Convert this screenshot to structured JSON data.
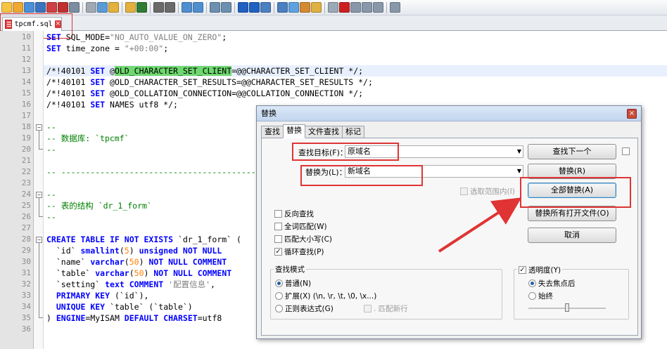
{
  "colors": {
    "accent": "#3c7fb1",
    "highlight_red": "#e03434",
    "match_green": "#6fd86f",
    "keyword": "#0000ff",
    "comment": "#008000"
  },
  "file_tab": {
    "label": "tpcmf.sql",
    "icon": "document-icon",
    "close_icon": "close-icon"
  },
  "toolbar_icons": [
    "new-file-icon",
    "open-icon",
    "save-icon",
    "save-all-icon",
    "close-icon",
    "close-all-icon",
    "print-icon",
    "cut-icon",
    "copy-icon",
    "paste-icon",
    "undo-icon",
    "redo-icon",
    "find-icon",
    "replace-icon",
    "zoom-in-icon",
    "zoom-out-icon",
    "sync-v-icon",
    "sync-h-icon",
    "wrap-icon",
    "all-chars-icon",
    "indent-guide-icon",
    "udl-icon",
    "doc-map-icon",
    "function-list-icon",
    "folder-icon",
    "monitor-icon",
    "record-icon",
    "stop-icon",
    "play-icon",
    "play-multi-icon",
    "save-macro-icon"
  ],
  "lines": [
    {
      "n": "10",
      "t": "SET SQL_MODE=\"NO_AUTO_VALUE_ON_ZERO\";"
    },
    {
      "n": "11",
      "t": "SET time_zone = \"+00:00\";"
    },
    {
      "n": "12",
      "t": ""
    },
    {
      "n": "13",
      "t": "/*!40101 SET @OLD_CHARACTER_SET_CLIENT=@@CHARACTER_SET_CLIENT */;"
    },
    {
      "n": "14",
      "t": "/*!40101 SET @OLD_CHARACTER_SET_RESULTS=@@CHARACTER_SET_RESULTS */;"
    },
    {
      "n": "15",
      "t": "/*!40101 SET @OLD_COLLATION_CONNECTION=@@COLLATION_CONNECTION */;"
    },
    {
      "n": "16",
      "t": "/*!40101 SET NAMES utf8 */;"
    },
    {
      "n": "17",
      "t": ""
    },
    {
      "n": "18",
      "t": "--"
    },
    {
      "n": "19",
      "t": "-- 数据库: `tpcmf`"
    },
    {
      "n": "20",
      "t": "--"
    },
    {
      "n": "21",
      "t": ""
    },
    {
      "n": "22",
      "t": "-- --------------------------------------------------------"
    },
    {
      "n": "23",
      "t": ""
    },
    {
      "n": "24",
      "t": "--"
    },
    {
      "n": "25",
      "t": "-- 表的结构 `dr_1_form`"
    },
    {
      "n": "26",
      "t": "--"
    },
    {
      "n": "27",
      "t": ""
    },
    {
      "n": "28",
      "t": "CREATE TABLE IF NOT EXISTS `dr_1_form` ("
    },
    {
      "n": "29",
      "t": "  `id` smallint(5) unsigned NOT NULL"
    },
    {
      "n": "30",
      "t": "  `name` varchar(50) NOT NULL COMMENT"
    },
    {
      "n": "31",
      "t": "  `table` varchar(50) NOT NULL COMMENT"
    },
    {
      "n": "32",
      "t": "  `setting` text COMMENT '配置信息',"
    },
    {
      "n": "33",
      "t": "  PRIMARY KEY (`id`),"
    },
    {
      "n": "34",
      "t": "  UNIQUE KEY `table` (`table`)"
    },
    {
      "n": "35",
      "t": ") ENGINE=MyISAM DEFAULT CHARSET=utf8"
    },
    {
      "n": "36",
      "t": ""
    }
  ],
  "dialog": {
    "title": "替换",
    "tabs": [
      "查找",
      "替换",
      "文件查找",
      "标记"
    ],
    "find_label": "查找目标(F)：",
    "find_value": "原域名",
    "replace_label": "替换为(L)：",
    "replace_value": "新域名",
    "in_selection": "选取范围内(I)",
    "buttons": {
      "find_next": "查找下一个",
      "replace": "替换(R)",
      "replace_all": "全部替换(A)",
      "replace_all_open": "替换所有打开文件(O)",
      "cancel": "取消"
    },
    "options": [
      {
        "label": "反向查找",
        "checked": false
      },
      {
        "label": "全词匹配(W)",
        "checked": false
      },
      {
        "label": "匹配大小写(C)",
        "checked": false
      },
      {
        "label": "循环查找(P)",
        "checked": true
      }
    ],
    "search_mode": {
      "title": "查找模式",
      "normal": "普通(N)",
      "extended": "扩展(X) (\\n, \\r, \\t, \\0, \\x...)",
      "regex": "正则表达式(G)",
      "dot_newline": ". 匹配新行",
      "selected": "normal"
    },
    "transparency": {
      "label": "透明度(Y)",
      "checked": true,
      "on_lose_focus": "失去焦点后",
      "always": "始终",
      "selected": "on_lose_focus",
      "level": 0.5
    }
  }
}
